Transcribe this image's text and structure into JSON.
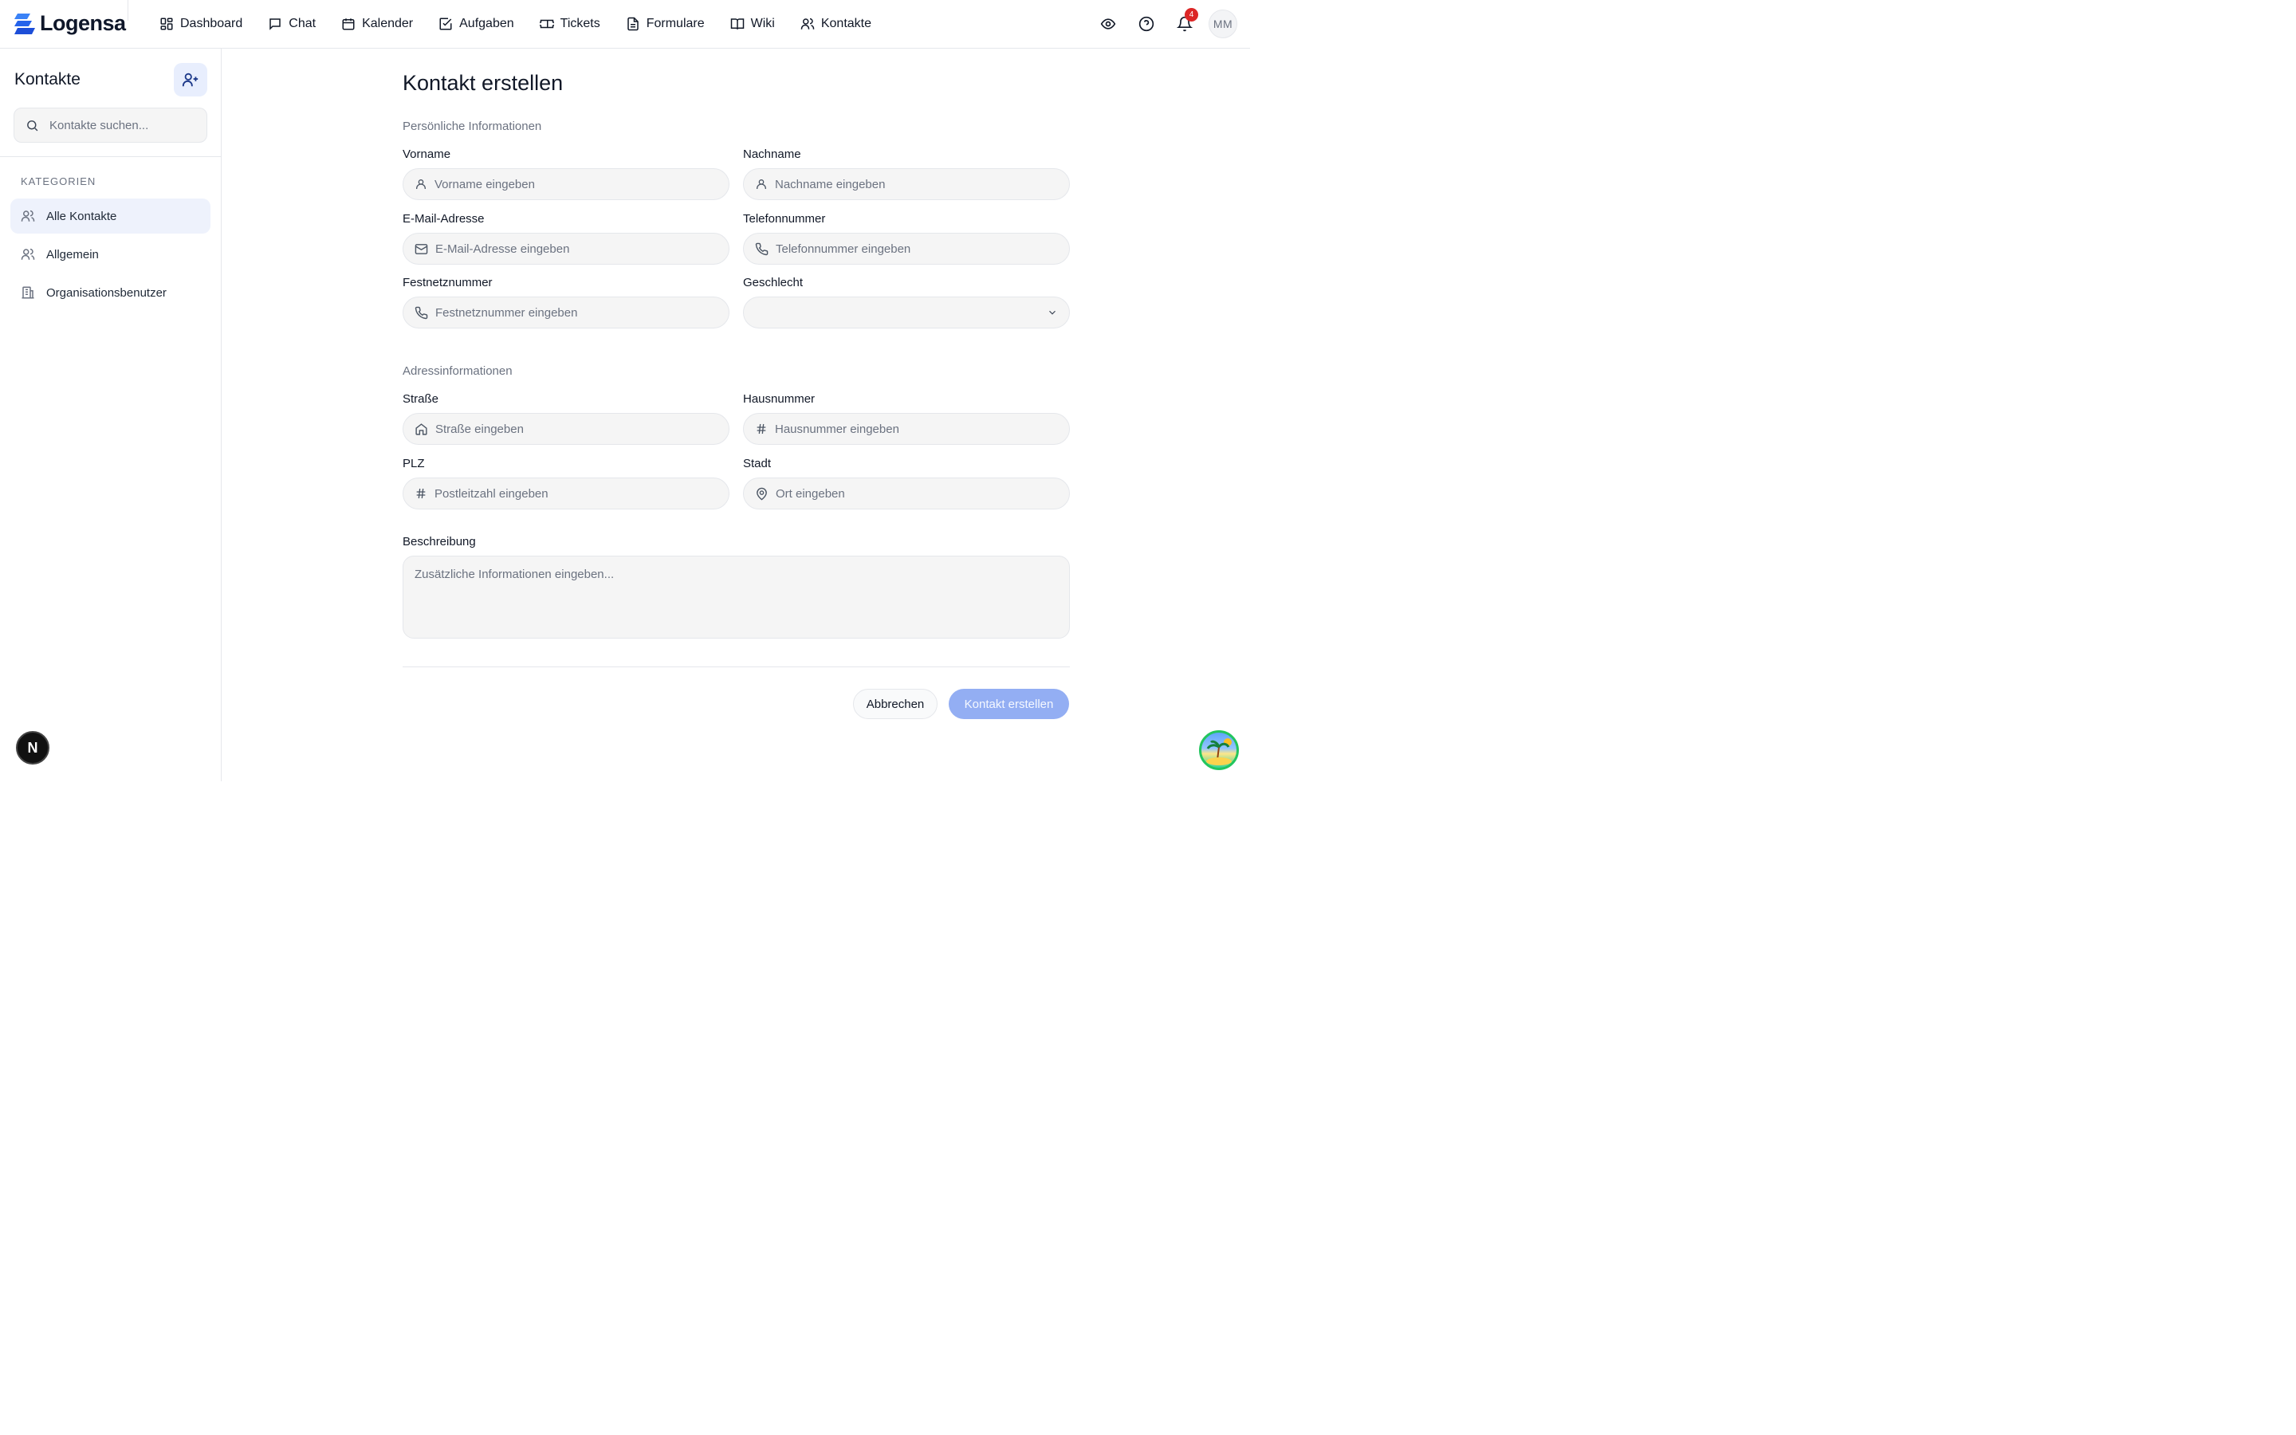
{
  "app": {
    "logo_text": "Logensa",
    "brand_color": "#2563eb"
  },
  "nav": {
    "items": [
      {
        "label": "Dashboard",
        "icon": "dashboard-icon"
      },
      {
        "label": "Chat",
        "icon": "chat-icon"
      },
      {
        "label": "Kalender",
        "icon": "calendar-icon"
      },
      {
        "label": "Aufgaben",
        "icon": "tasks-icon"
      },
      {
        "label": "Tickets",
        "icon": "ticket-icon"
      },
      {
        "label": "Formulare",
        "icon": "form-icon"
      },
      {
        "label": "Wiki",
        "icon": "book-icon"
      },
      {
        "label": "Kontakte",
        "icon": "contacts-icon"
      }
    ]
  },
  "topbar": {
    "notification_count": "4",
    "avatar_initials": "MM"
  },
  "sidebar": {
    "title": "Kontakte",
    "search_placeholder": "Kontakte suchen...",
    "category_heading": "KATEGORIEN",
    "items": [
      {
        "label": "Alle Kontakte",
        "active": true
      },
      {
        "label": "Allgemein",
        "active": false
      },
      {
        "label": "Organisationsbenutzer",
        "active": false
      }
    ]
  },
  "form": {
    "title": "Kontakt erstellen",
    "section_personal": "Persönliche Informationen",
    "section_address": "Adressinformationen",
    "fields": {
      "firstname": {
        "label": "Vorname",
        "placeholder": "Vorname eingeben"
      },
      "lastname": {
        "label": "Nachname",
        "placeholder": "Nachname eingeben"
      },
      "email": {
        "label": "E-Mail-Adresse",
        "placeholder": "E-Mail-Adresse eingeben"
      },
      "phone": {
        "label": "Telefonnummer",
        "placeholder": "Telefonnummer eingeben"
      },
      "landline": {
        "label": "Festnetznummer",
        "placeholder": "Festnetznummer eingeben"
      },
      "gender": {
        "label": "Geschlecht",
        "value": ""
      },
      "street": {
        "label": "Straße",
        "placeholder": "Straße eingeben"
      },
      "house_number": {
        "label": "Hausnummer",
        "placeholder": "Hausnummer eingeben"
      },
      "zip": {
        "label": "PLZ",
        "placeholder": "Postleitzahl eingeben"
      },
      "city": {
        "label": "Stadt",
        "placeholder": "Ort eingeben"
      },
      "description": {
        "label": "Beschreibung",
        "placeholder": "Zusätzliche Informationen eingeben..."
      }
    },
    "cancel_label": "Abbrechen",
    "submit_label": "Kontakt erstellen"
  },
  "dev": {
    "badge_letter": "N"
  }
}
